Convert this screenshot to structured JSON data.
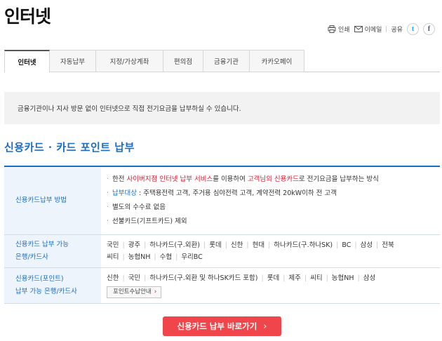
{
  "page": {
    "title": "인터넷"
  },
  "utils": {
    "print": "인쇄",
    "email": "이메일",
    "share": "공유",
    "twitter": "t",
    "facebook": "f"
  },
  "tabs": [
    {
      "label": "인터넷",
      "active": true
    },
    {
      "label": "자동납부",
      "active": false
    },
    {
      "label": "지정/가상계좌",
      "active": false
    },
    {
      "label": "편의점",
      "active": false
    },
    {
      "label": "금융기관",
      "active": false
    },
    {
      "label": "카카오페이",
      "active": false
    }
  ],
  "info": {
    "text": "금융기관이나 지사 방문 없이 인터넷으로 직접 전기요금을 납부하실 수 있습니다."
  },
  "section": {
    "title": "신용카드 · 카드 포인트 납부"
  },
  "table": {
    "row1": {
      "header": "신용카드납부 방법",
      "b1_p1": "한전 ",
      "b1_red1": "사이버지점 인터넷 납부 서비스",
      "b1_p2": "를 이용하여 ",
      "b1_red2": "고객님의 신용카드",
      "b1_p3": "로 전기요금을 납부하는 방식",
      "b2_blue": "납부대상",
      "b2_rest": " : 주택용전력 고객, 주거용 심야전력 고객, 계약전력 20kW이하 전 고객",
      "b3": "별도의 수수료 없음",
      "b4": "선불카드(기프트카드) 제외"
    },
    "row2": {
      "header_l1": "신용카드 납부 가능",
      "header_l2": "은행/카드사",
      "line1": [
        "국민",
        "광주",
        "하나카드(구.외환)",
        "롯데",
        "신한",
        "현대",
        "하나카드(구.하나SK)",
        "BC",
        "삼성",
        "전북"
      ],
      "line2": [
        "씨티",
        "농협NH",
        "수협",
        "우리BC"
      ]
    },
    "row3": {
      "header_l1": "신용카드(포인트)",
      "header_l2": "납부 가능 은행/카드사",
      "line1": [
        "신한",
        "국민",
        "하나카드(구.외환 및 하나SK카드 포함)",
        "롯데",
        "제주",
        "씨티",
        "농협NH",
        "삼성"
      ],
      "guide_button": "포인트수납안내"
    }
  },
  "pay_button": {
    "label": "신용카드 납부 바로가기"
  },
  "colors": {
    "accent_blue": "#1a6cc4",
    "accent_red": "#e2142a",
    "button_red": "#f0464b"
  }
}
